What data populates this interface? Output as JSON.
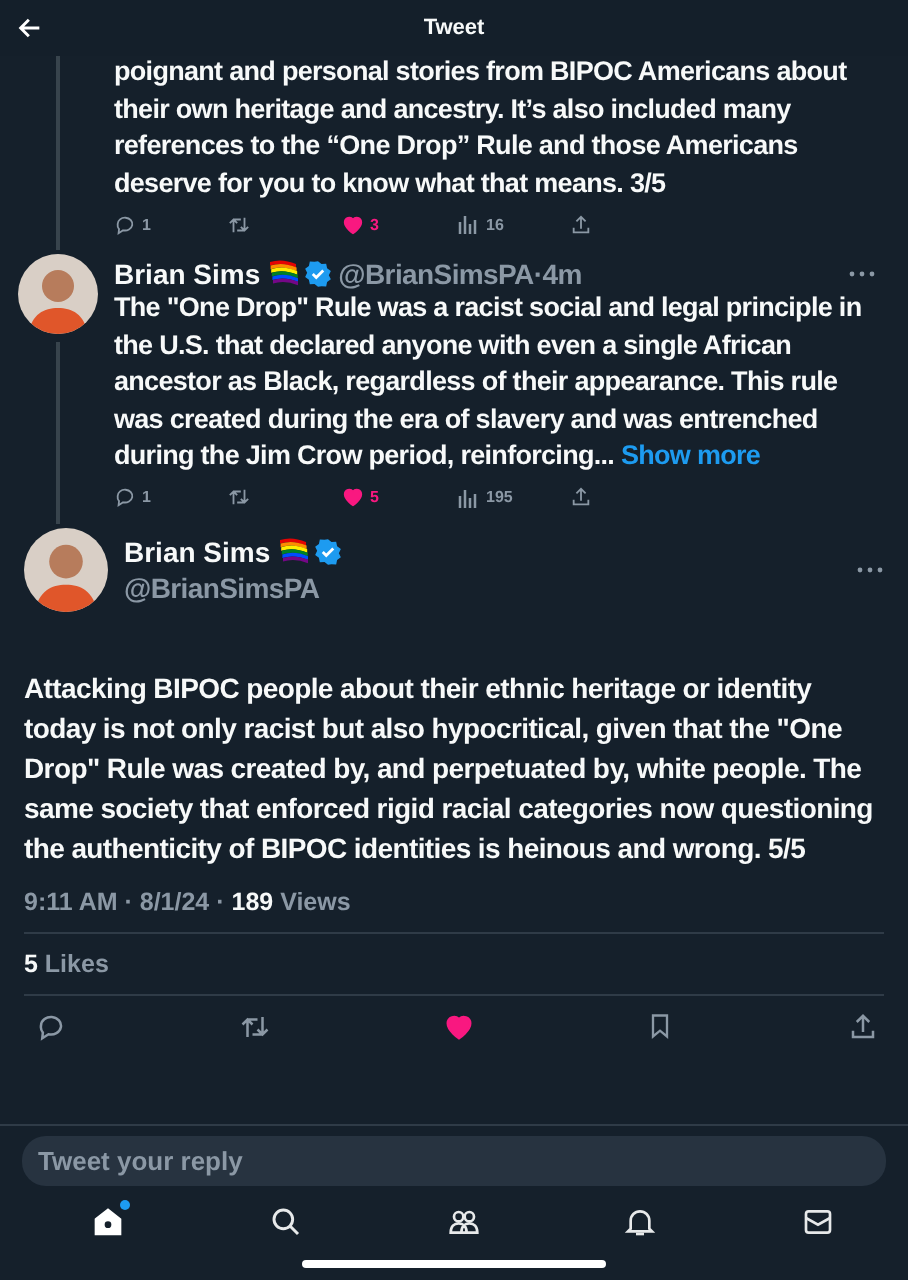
{
  "header": {
    "title": "Tweet"
  },
  "thread": [
    {
      "text": "poignant and personal stories from BIPOC Americans about their own heritage and ancestry. It’s also included many references to the “One Drop” Rule and those Americans deserve for you to know what that means. 3/5",
      "actions": {
        "replies": "1",
        "likes": "3",
        "liked": true,
        "views": "16"
      }
    },
    {
      "name": "Brian Sims",
      "meta": "@BrianSimsPA·4m",
      "text": "The \"One Drop\" Rule was a racist social and legal principle in the U.S. that declared anyone with even a single African ancestor as Black, regardless of their appearance. This rule was created during the era of slavery and was entrenched during the Jim Crow period, reinforcing...",
      "show_more": "Show more",
      "actions": {
        "replies": "1",
        "likes": "5",
        "liked": true,
        "views": "195"
      }
    }
  ],
  "main": {
    "name": "Brian Sims",
    "handle": "@BrianSimsPA",
    "text": "Attacking BIPOC people about their ethnic heritage or identity today is not only racist but also hypocritical, given that the \"One Drop\" Rule was created by, and perpetuated by, white people. The same society that enforced rigid racial categories now questioning the authenticity of BIPOC identities is heinous and wrong. 5/5",
    "meta": "9:11 AM · 8/1/24 · **189** Views",
    "likes": "**5** Likes",
    "liked": true
  },
  "reply": {
    "placeholder": "Tweet your reply"
  },
  "nav": [
    {
      "kind": "home",
      "selected": true,
      "unread": true
    },
    {
      "kind": "search",
      "selected": false,
      "unread": false
    },
    {
      "kind": "communities",
      "selected": false,
      "unread": false
    },
    {
      "kind": "notifications",
      "selected": false,
      "unread": false
    },
    {
      "kind": "messages",
      "selected": false,
      "unread": false
    }
  ]
}
